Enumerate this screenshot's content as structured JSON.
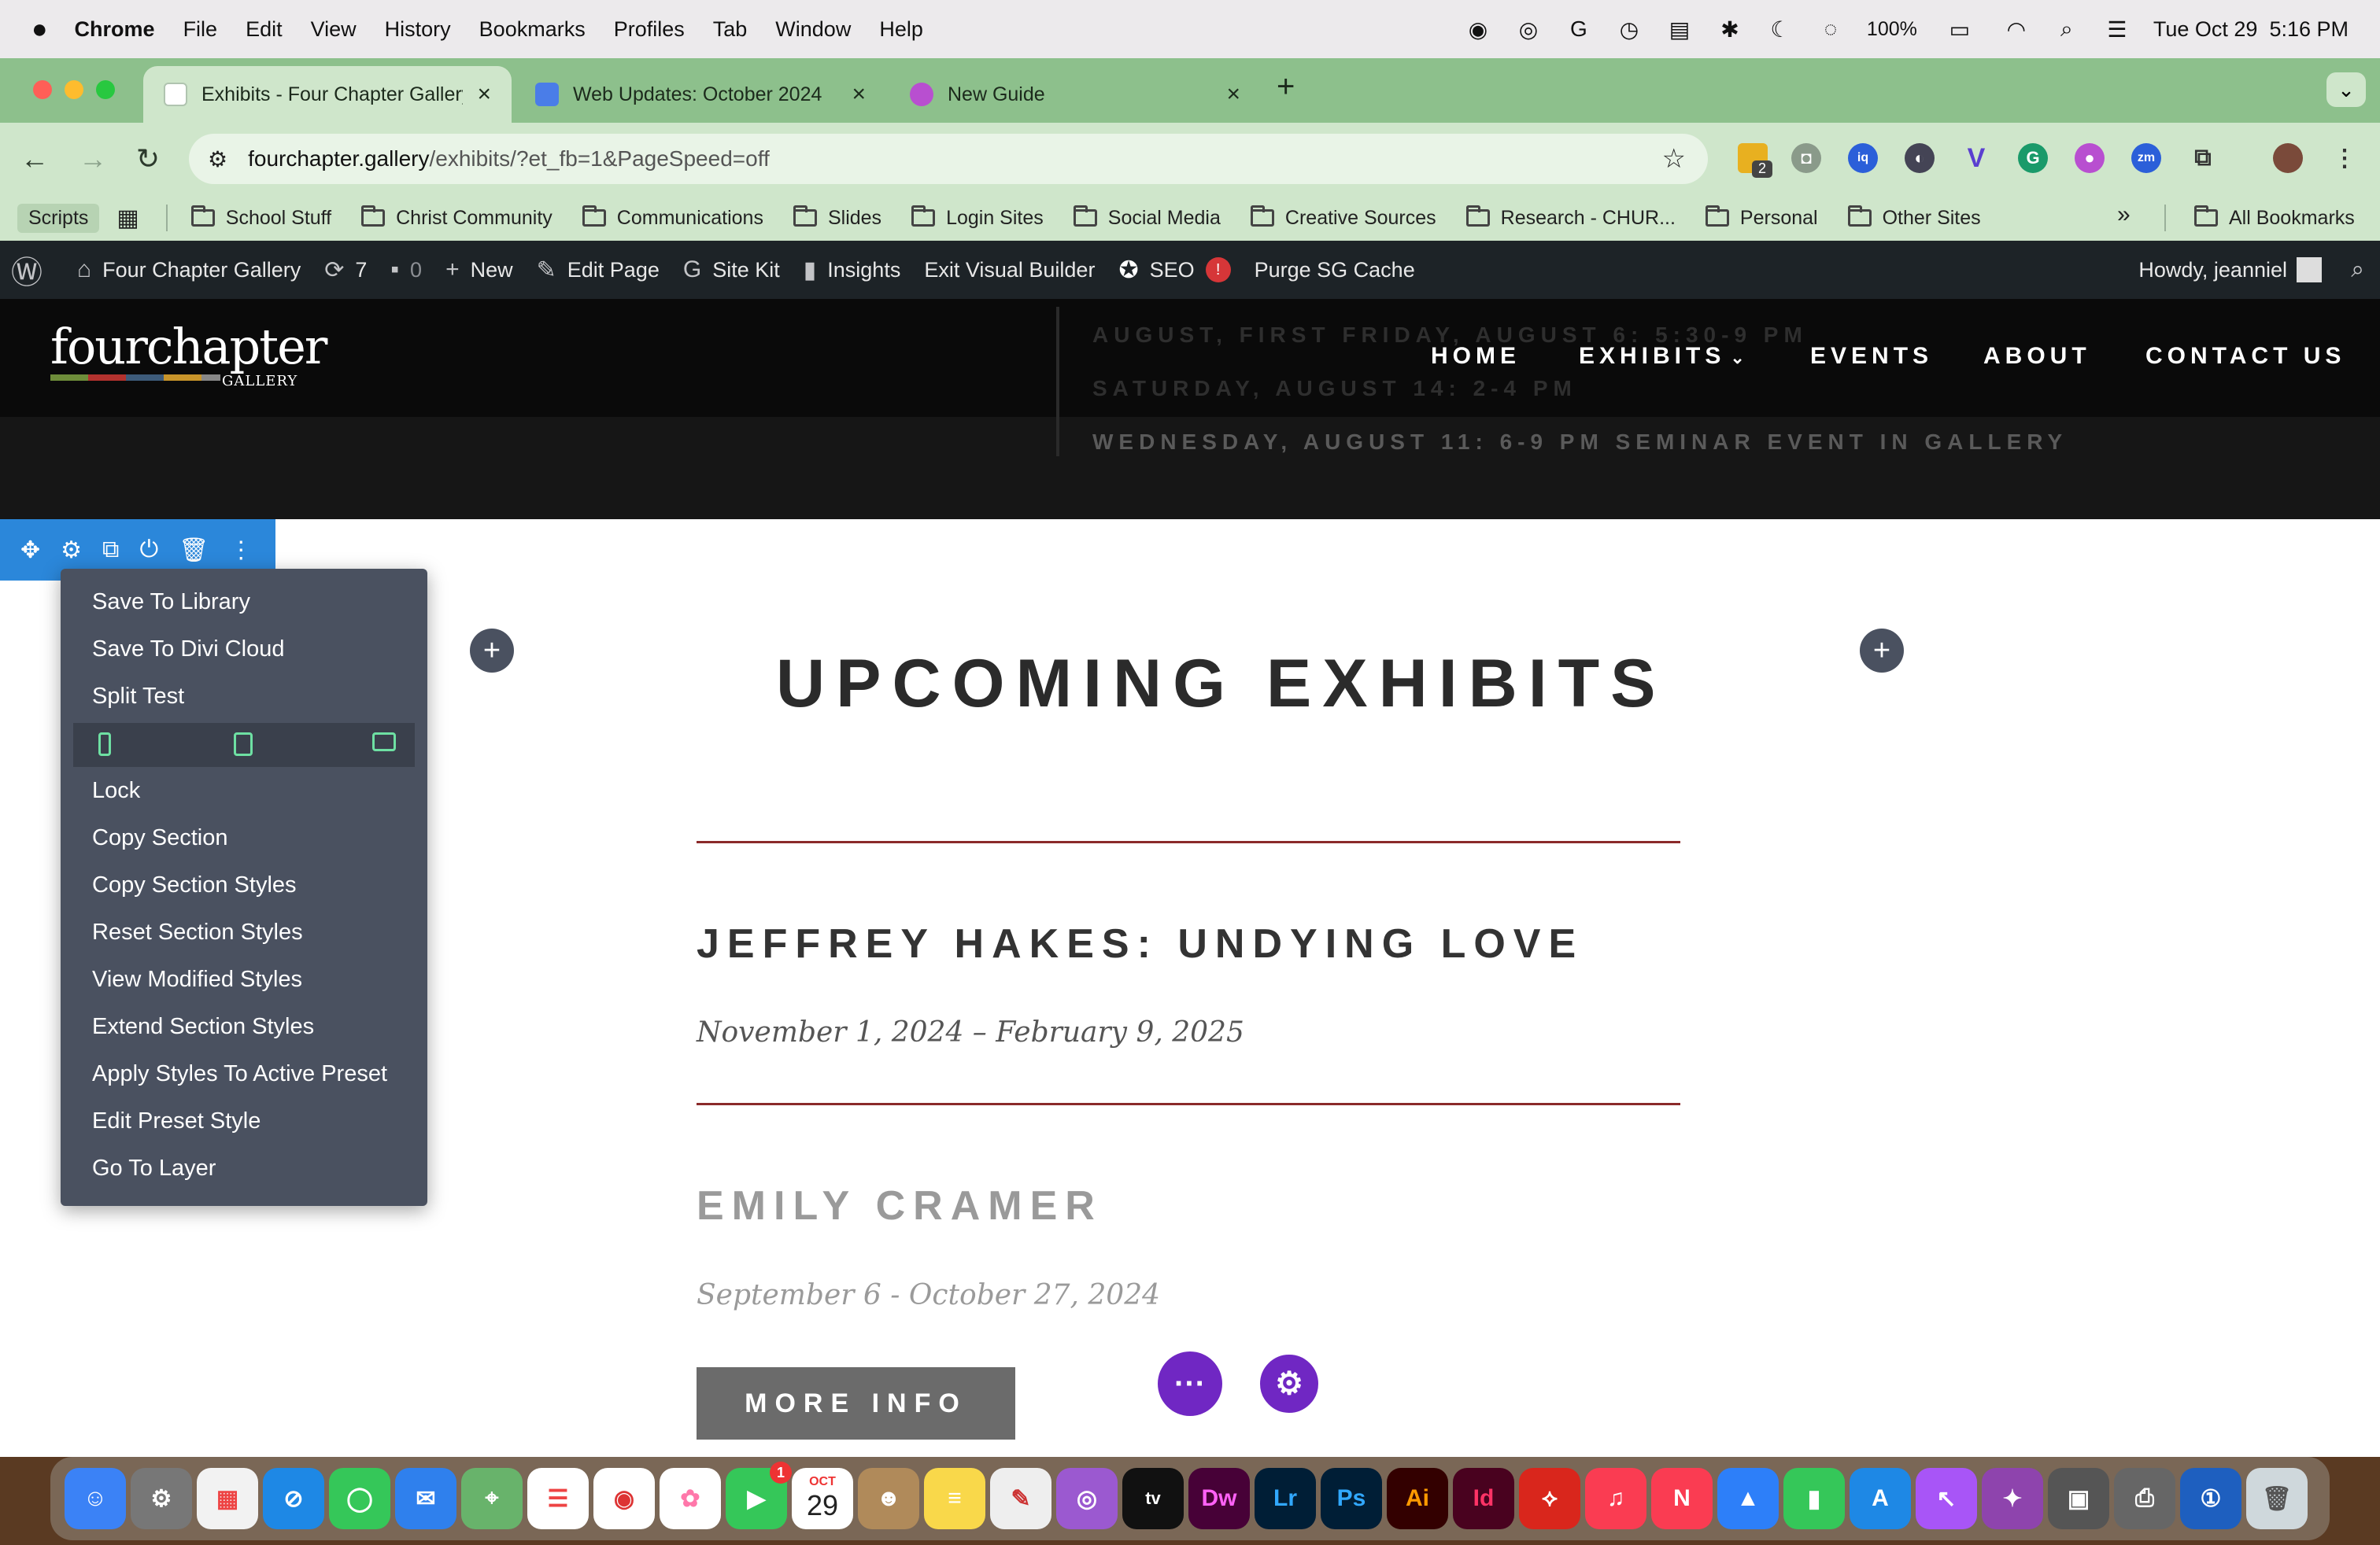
{
  "menubar": {
    "app": "Chrome",
    "items": [
      "File",
      "Edit",
      "View",
      "History",
      "Bookmarks",
      "Profiles",
      "Tab",
      "Window",
      "Help"
    ],
    "battery": "100%",
    "datetime": "Tue Oct 29  5:16 PM"
  },
  "tabs": [
    {
      "title": "Exhibits - Four Chapter Gallery",
      "active": true
    },
    {
      "title": "Web Updates: October 2024",
      "active": false
    },
    {
      "title": "New Guide",
      "active": false
    }
  ],
  "address": {
    "domain": "fourchapter.gallery",
    "path": "/exhibits/?et_fb=1&PageSpeed=off"
  },
  "extensions": {
    "badge_count": "2"
  },
  "bookmarks": {
    "scripts": "Scripts",
    "folders": [
      "School Stuff",
      "Christ Community",
      "Communications",
      "Slides",
      "Login Sites",
      "Social Media",
      "Creative Sources",
      "Research - CHUR...",
      "Personal",
      "Other Sites"
    ],
    "overflow": "»",
    "all": "All Bookmarks"
  },
  "wpbar": {
    "site": "Four Chapter Gallery",
    "updates": "7",
    "comments": "0",
    "new": "New",
    "edit": "Edit Page",
    "sitekit": "Site Kit",
    "insights": "Insights",
    "exit": "Exit Visual Builder",
    "seo": "SEO",
    "seo_badge": "!",
    "purge": "Purge SG Cache",
    "howdy": "Howdy, jeanniel"
  },
  "site": {
    "logo_main": "fourchapter",
    "logo_sub": "GALLERY",
    "nav": [
      "HOME",
      "EXHIBITS",
      "EVENTS",
      "ABOUT",
      "CONTACT US"
    ],
    "hero_lines": [
      "AUGUST, FIRST FRIDAY, AUGUST 6: 5:30-9 PM",
      "SATURDAY, AUGUST 14: 2-4 PM",
      "WEDNESDAY, AUGUST 11: 6-9 PM SEMINAR EVENT IN GALLERY"
    ]
  },
  "context_menu": {
    "items": [
      "Save To Library",
      "Save To Divi Cloud",
      "Split Test",
      "Lock",
      "Copy Section",
      "Copy Section Styles",
      "Reset Section Styles",
      "View Modified Styles",
      "Extend Section Styles",
      "Apply Styles To Active Preset",
      "Edit Preset Style",
      "Go To Layer"
    ]
  },
  "content": {
    "heading": "UPCOMING EXHIBITS",
    "exhibits": [
      {
        "title": "JEFFREY HAKES: UNDYING LOVE",
        "dates": "November 1, 2024 – February 9, 2025"
      },
      {
        "title": "EMILY CRAMER",
        "dates": "September 6 - October 27, 2024"
      }
    ],
    "more_info": "MORE INFO"
  },
  "dock": {
    "calendar_month": "OCT",
    "calendar_day": "29",
    "facetime_badge": "1",
    "apps": [
      "Dw",
      "Lr",
      "Ps",
      "Ai",
      "Id"
    ]
  },
  "colors": {
    "divi_blue": "#2b87da",
    "divi_purple": "#7027c3",
    "menu_bg": "#4a5160",
    "rule_red": "#8b2a2a",
    "chrome_green": "#8dc08c"
  }
}
